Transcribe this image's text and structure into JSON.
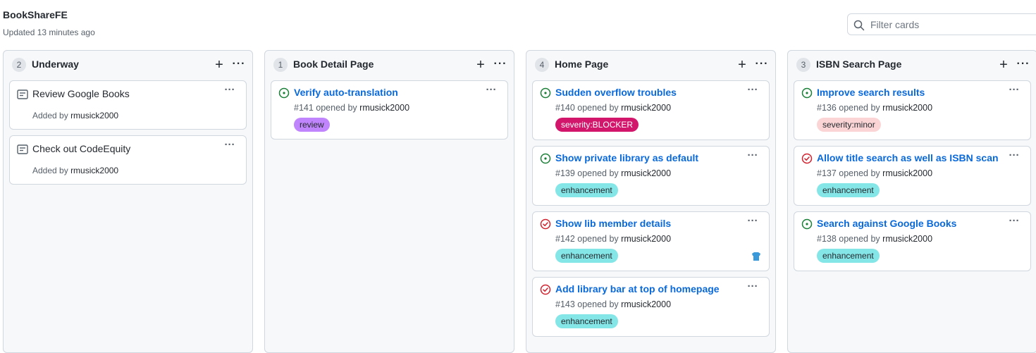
{
  "project": {
    "title": "BookShareFE",
    "updated": "Updated 13 minutes ago",
    "filter_placeholder": "Filter cards"
  },
  "columns": [
    {
      "name": "Underway",
      "count": "2",
      "cards": [
        {
          "type": "note",
          "text": "Review Google Books",
          "added_prefix": "Added by",
          "user": "rmusick2000"
        },
        {
          "type": "note",
          "text": "Check out CodeEquity",
          "added_prefix": "Added by",
          "user": "rmusick2000"
        }
      ]
    },
    {
      "name": "Book Detail Page",
      "count": "1",
      "cards": [
        {
          "type": "issue",
          "status": "open",
          "title": "Verify auto-translation",
          "number": "#141 opened by",
          "user": "rmusick2000",
          "label": "review"
        }
      ]
    },
    {
      "name": "Home Page",
      "count": "4",
      "cards": [
        {
          "type": "issue",
          "status": "open",
          "title": "Sudden overflow troubles",
          "number": "#140 opened by",
          "user": "rmusick2000",
          "label": "severity:BLOCKER"
        },
        {
          "type": "issue",
          "status": "open",
          "title": "Show private library as default",
          "number": "#139 opened by",
          "user": "rmusick2000",
          "label": "enhancement"
        },
        {
          "type": "issue",
          "status": "closed",
          "title": "Show lib member details",
          "number": "#142 opened by",
          "user": "rmusick2000",
          "label": "enhancement"
        },
        {
          "type": "issue",
          "status": "closed",
          "title": "Add library bar at top of homepage",
          "number": "#143 opened by",
          "user": "rmusick2000",
          "label": "enhancement"
        }
      ]
    },
    {
      "name": "ISBN Search Page",
      "count": "3",
      "cards": [
        {
          "type": "issue",
          "status": "open",
          "title": "Improve search results",
          "number": "#136 opened by",
          "user": "rmusick2000",
          "label": "severity:minor"
        },
        {
          "type": "issue",
          "status": "closed",
          "title": "Allow title search as well as ISBN scan",
          "number": "#137 opened by",
          "user": "rmusick2000",
          "label": "enhancement"
        },
        {
          "type": "issue",
          "status": "open",
          "title": "Search against Google Books",
          "number": "#138 opened by",
          "user": "rmusick2000",
          "label": "enhancement"
        }
      ]
    }
  ],
  "colors": {
    "open": "#1a7f37",
    "closed": "#cf222e",
    "link": "#0969da",
    "review": "#c084fc",
    "blocker": "#d2166b",
    "enhancement": "#84e6e6",
    "minor": "#fbd5d5"
  },
  "icons": {
    "open": "issue-opened-icon",
    "closed": "issue-closed-icon",
    "note": "note-icon",
    "search": "search-icon",
    "assignee": "avatar"
  }
}
